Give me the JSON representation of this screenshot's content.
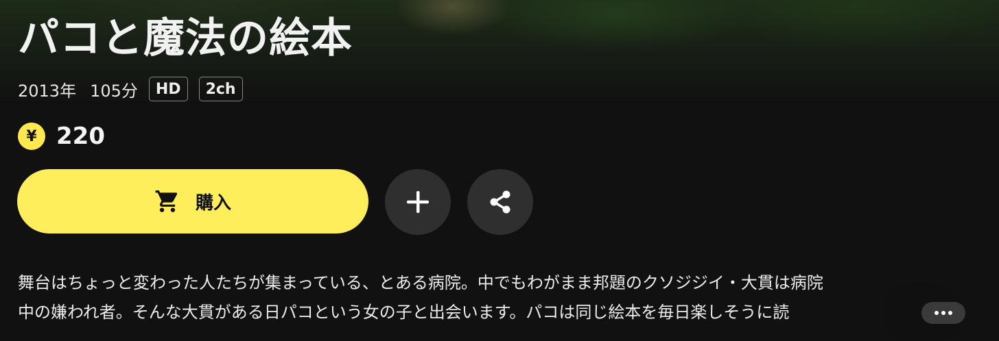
{
  "title": "パコと魔法の絵本",
  "meta": {
    "year": "2013年",
    "duration": "105分",
    "tags": [
      "HD",
      "2ch"
    ]
  },
  "price": {
    "currency_symbol": "¥",
    "value": "220"
  },
  "actions": {
    "buy_label": "購入",
    "add_icon": "plus-icon",
    "share_icon": "share-icon"
  },
  "synopsis": {
    "line1": "舞台はちょっと変わった人たちが集まっている、とある病院。中でもわがまま邦題のクソジジイ・大貫は病院",
    "line2": "中の嫌われ者。そんな大貫がある日パコという女の子と出会います。パコは同じ絵本を毎日楽しそうに読"
  },
  "colors": {
    "accent": "#ffee5c",
    "background": "#111111",
    "button_dark": "#2f2f2f"
  }
}
